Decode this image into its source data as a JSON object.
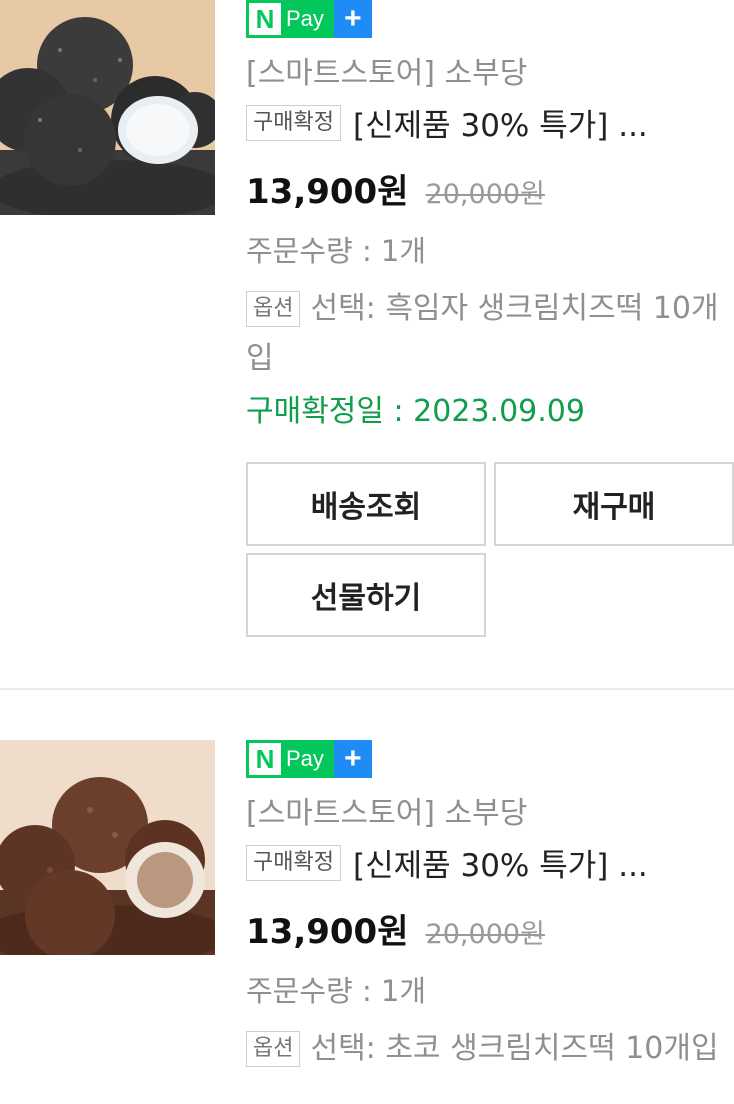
{
  "orders": [
    {
      "npay": {
        "logo_letter": "N",
        "label": "Pay",
        "plus": "+"
      },
      "store": "[스마트스토어] 소부당",
      "status_badge": "구매확정",
      "title": "[신제품 30% 특가] ...",
      "price": "13,900원",
      "original_price": "20,000원",
      "quantity": "주문수량 : 1개",
      "option_badge": "옵션",
      "option_text": "선택: 흑임자 생크림치즈떡 10개입",
      "confirm_date": "구매확정일 : 2023.09.09",
      "buttons": {
        "track": "배송조회",
        "rebuy": "재구매",
        "gift": "선물하기"
      }
    },
    {
      "npay": {
        "logo_letter": "N",
        "label": "Pay",
        "plus": "+"
      },
      "store": "[스마트스토어] 소부당",
      "status_badge": "구매확정",
      "title": "[신제품 30% 특가] ...",
      "price": "13,900원",
      "original_price": "20,000원",
      "quantity": "주문수량 : 1개",
      "option_badge": "옵션",
      "option_text": "선택: 초코 생크림치즈떡 10개입"
    }
  ],
  "colors": {
    "npay_green": "#03c75a",
    "npay_blue": "#1f8cf6",
    "confirm_green": "#0f9e4a",
    "muted_text": "#8f8f8f"
  }
}
